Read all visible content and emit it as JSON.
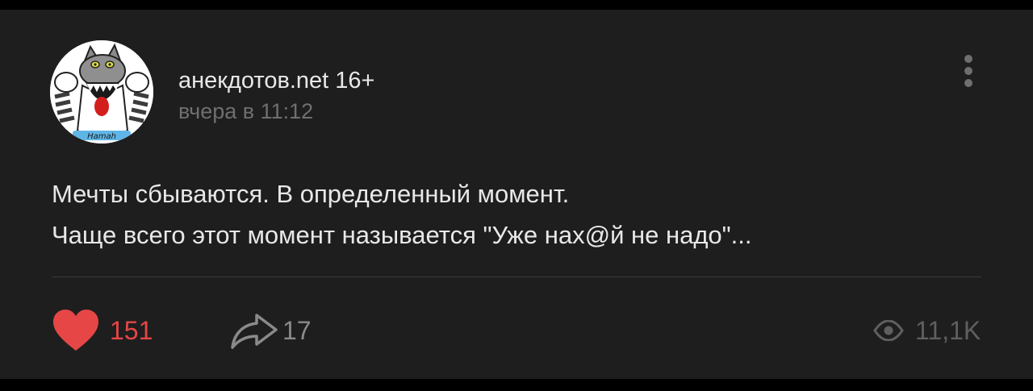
{
  "post": {
    "author": "анекдотов.net 16+",
    "time": "вчера в 11:12",
    "text_lines": [
      "Мечты сбываются. В определенный момент.",
      "Чаще всего этот момент называется \"Уже нах@й не надо\"..."
    ],
    "avatar_caption": "Hamah"
  },
  "actions": {
    "likes": "151",
    "shares": "17",
    "views": "11,1K"
  },
  "icons": {
    "like": "heart-icon",
    "share": "share-arrow-icon",
    "views": "eye-icon",
    "menu": "more-vertical-icon"
  },
  "colors": {
    "background": "#000000",
    "card": "#1e1e1e",
    "text": "#e8e8e8",
    "muted": "#6f6f6f",
    "like": "#e64646"
  }
}
